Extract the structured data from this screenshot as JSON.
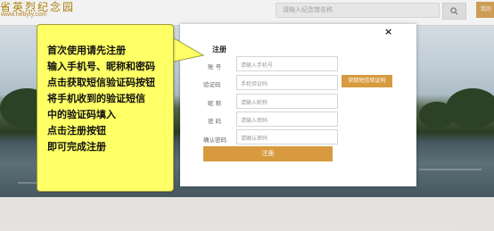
{
  "header": {
    "site_title": "省英烈纪念园",
    "site_url": "www.hebyly.com",
    "search_placeholder": "请输入纪念馆名称",
    "corner_label": "我的"
  },
  "modal": {
    "title": "注册",
    "close_label": "×",
    "fields": [
      {
        "label": "账  号",
        "placeholder": "请输入手机号"
      },
      {
        "label": "验证码",
        "placeholder": "手机验证码"
      },
      {
        "label": "昵  称",
        "placeholder": "请输入昵称"
      },
      {
        "label": "密  码",
        "placeholder": "请输入密码"
      },
      {
        "label": "确认密码",
        "placeholder": "请确认密码"
      }
    ],
    "sms_button": "获取短信验证码",
    "submit_button": "注册"
  },
  "tip": {
    "lines": [
      "首次使用请先注册",
      "输入手机号、昵称和密码",
      "点击获取短信验证码按钮",
      "将手机收到的验证短信",
      "中的验证码填入",
      "点击注册按钮",
      "即可完成注册"
    ]
  },
  "colors": {
    "accent": "#d79a3e",
    "tip_bg": "#ffff66"
  },
  "icons": {
    "search": "search-icon",
    "close": "close-icon"
  }
}
